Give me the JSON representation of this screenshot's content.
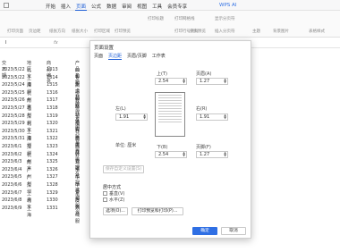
{
  "app": {
    "title": "WPS AI",
    "menu": [
      "开始",
      "插入",
      "页面",
      "公式",
      "数据",
      "审阅",
      "视图",
      "工具",
      "会员专享"
    ],
    "active_menu": "页面"
  },
  "ribbon": {
    "items": [
      "打印页面",
      "页边距",
      "纸张方向",
      "纸张大小",
      "打印区域",
      "打印预览",
      "打印标题",
      "打印网格线",
      "打印行号列标",
      "显示分页符",
      "插入分页符",
      "分页预览",
      "主题",
      "背景图片",
      "表格样式"
    ]
  },
  "formula": {
    "cell": "I",
    "fx": "fx"
  },
  "sheet": {
    "rows": [
      [
        "2023/5/22",
        "北京",
        "1313",
        "四和箱"
      ],
      [
        "2023/5/22",
        "上海",
        "1314",
        "安斯卡利"
      ],
      [
        "2023/5/24",
        "深圳",
        "1315",
        "高端品牌"
      ],
      [
        "2023/5/25",
        "杭州",
        "1316",
        "价对比"
      ],
      [
        "2023/5/26",
        "南京",
        "1317",
        "智林样本"
      ],
      [
        "2023/5/27",
        "福州",
        "1318",
        "运动休闲"
      ],
      [
        "2023/5/28",
        "深圳",
        "1319",
        "长袖衬"
      ],
      [
        "2023/5/29",
        "北京",
        "1320",
        "庄周贸易"
      ],
      [
        "2023/5/30",
        "上海",
        "1321",
        "日精卡丹"
      ],
      [
        "2023/5/31",
        "深圳",
        "1322",
        "高级方"
      ],
      [
        "2023/6/1",
        "深圳",
        "1323",
        "西装男"
      ],
      [
        "2023/6/2",
        "杭州",
        "1324",
        "好管理"
      ],
      [
        "2023/6/3",
        "南京",
        "1325",
        "润建外"
      ],
      [
        "2023/6/4",
        "广州",
        "1326",
        "李泓冠"
      ],
      [
        "2023/6/5",
        "广州",
        "1327",
        "牛仔裤"
      ],
      [
        "2023/6/6",
        "深圳",
        "1328",
        "中长裙"
      ],
      [
        "2023/6/7",
        "上海",
        "1329",
        "家居服"
      ],
      [
        "2023/6/8",
        "北京",
        "1330",
        "皮夹克"
      ],
      [
        "2023/6/9",
        "上海",
        "1331",
        "羽绒服"
      ]
    ],
    "headers": [
      "交日期",
      "地区",
      "商品编号",
      "产品名"
    ]
  },
  "dialog": {
    "title": "页面设置",
    "tabs": [
      "页面",
      "页边距",
      "页眉/页脚",
      "工作表"
    ],
    "active_tab": "页边距",
    "top_label": "上(T)",
    "top_value": "2.54",
    "header_label": "页眉(A)",
    "header_value": "1.27",
    "left_label": "左(L)",
    "left_value": "1.91",
    "right_label": "右(R)",
    "right_value": "1.91",
    "unit": "单位: 厘米",
    "bottom_label": "下(B)",
    "bottom_value": "2.54",
    "footer_label": "页脚(F)",
    "footer_value": "1.27",
    "save_custom": "保存自定义设置(S)",
    "center_title": "居中方式",
    "center_v": "垂直(V)",
    "center_h": "水平(Z)",
    "options_btn": "选项(O)...",
    "print_preview_btn": "打印预览和打印(P)...",
    "ok": "确定",
    "cancel": "取消"
  }
}
